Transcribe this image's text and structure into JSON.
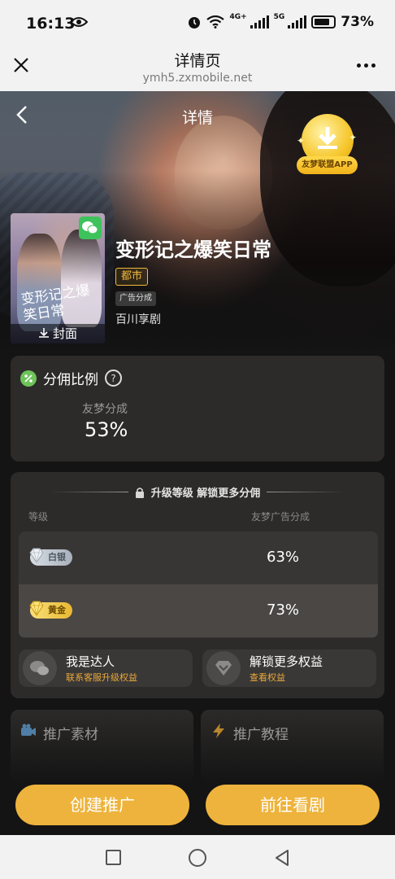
{
  "status_bar": {
    "time": "16:13",
    "network": "4G+",
    "network2": "5G",
    "battery": "73%"
  },
  "webview": {
    "title": "详情页",
    "url": "ymh5.zxmobile.net"
  },
  "header": {
    "title": "详情"
  },
  "app_badge": {
    "label": "友梦联盟APP"
  },
  "drama": {
    "cover_label": "封面",
    "poster_title": "变形记之爆笑日常",
    "title": "变形记之爆笑日常",
    "genre": "都市",
    "type": "广告分成",
    "provider": "百川享剧"
  },
  "commission": {
    "heading": "分佣比例",
    "label": "友梦分成",
    "value": "53%"
  },
  "upgrade": {
    "heading": "升级等级 解锁更多分佣",
    "col_level": "等级",
    "col_share": "友梦广告分成",
    "tiers": [
      {
        "name": "白银",
        "value": "63%"
      },
      {
        "name": "黄金",
        "value": "73%"
      }
    ],
    "actions": [
      {
        "title": "我是达人",
        "subtitle": "联系客服升级权益"
      },
      {
        "title": "解锁更多权益",
        "subtitle": "查看权益"
      }
    ]
  },
  "tiles": [
    {
      "label": "推广素材"
    },
    {
      "label": "推广教程"
    }
  ],
  "buttons": {
    "create": "创建推广",
    "watch": "前往看剧"
  },
  "colors": {
    "accent": "#eeb33c",
    "tag": "#f2b93b",
    "link": "#e9a93a"
  }
}
